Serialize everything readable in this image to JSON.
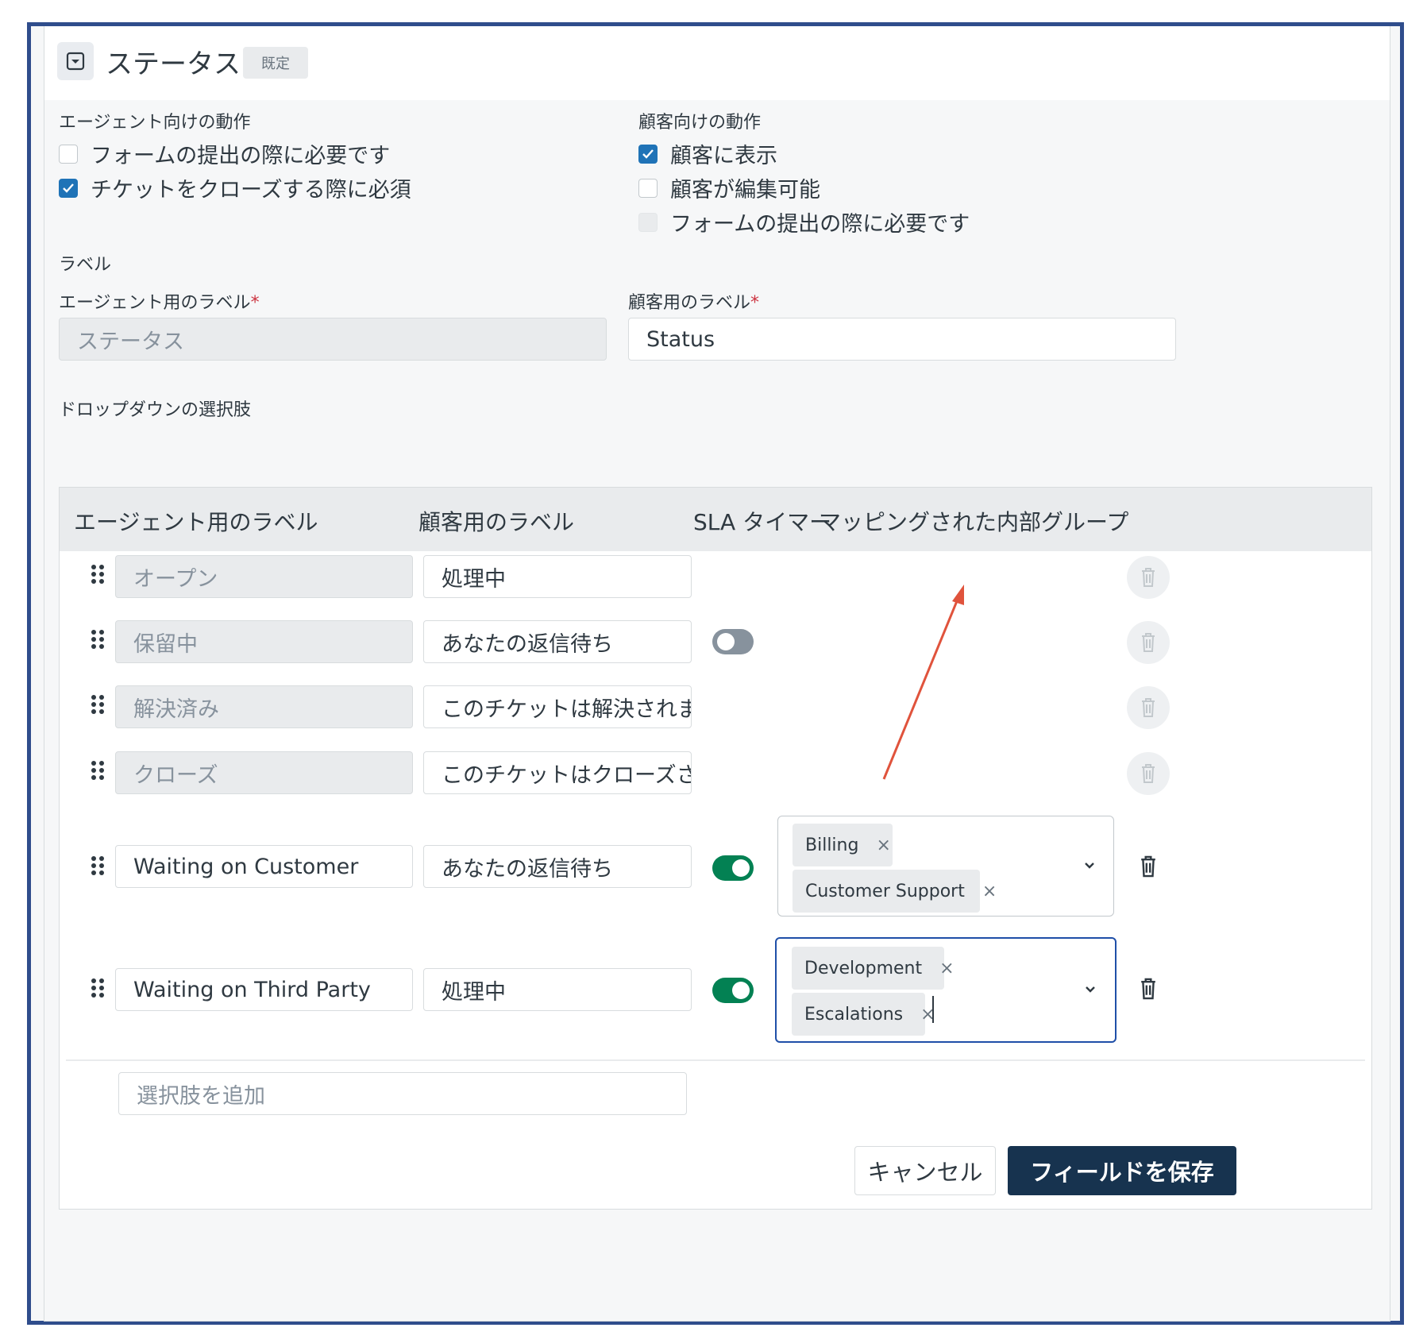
{
  "header": {
    "title": "ステータス",
    "badge": "既定",
    "icon": "dropdown-field-icon"
  },
  "agent_behavior": {
    "heading": "エージェント向けの動作",
    "options": [
      {
        "label": "フォームの提出の際に必要です",
        "checked": false
      },
      {
        "label": "チケットをクローズする際に必須",
        "checked": true
      }
    ]
  },
  "customer_behavior": {
    "heading": "顧客向けの動作",
    "options": [
      {
        "label": "顧客に表示",
        "checked": true
      },
      {
        "label": "顧客が編集可能",
        "checked": false
      },
      {
        "label": "フォームの提出の際に必要です",
        "checked": false,
        "disabled": true
      }
    ]
  },
  "labels": {
    "heading": "ラベル",
    "agent_label_title": "エージェント用のラベル",
    "customer_label_title": "顧客用のラベル",
    "required_mark": "*",
    "agent_label_value": "ステータス",
    "customer_label_value": "Status"
  },
  "dropdown": {
    "heading": "ドロップダウンの選択肢",
    "columns": [
      "エージェント用のラベル",
      "顧客用のラベル",
      "SLA タイマー",
      "マッピングされた内部グループ"
    ],
    "rows": [
      {
        "agent": "オープン",
        "customer": "処理中",
        "agent_readonly": true,
        "sla": null,
        "groups": [],
        "trash_disabled": true
      },
      {
        "agent": "保留中",
        "customer": "あなたの返信待ち",
        "agent_readonly": true,
        "sla": "off",
        "groups": [],
        "trash_disabled": true
      },
      {
        "agent": "解決済み",
        "customer": "このチケットは解決されまl",
        "agent_readonly": true,
        "sla": null,
        "groups": [],
        "trash_disabled": true
      },
      {
        "agent": "クローズ",
        "customer": "このチケットはクローズさオ",
        "agent_readonly": true,
        "sla": null,
        "groups": [],
        "trash_disabled": true
      },
      {
        "agent": "Waiting on Customer",
        "customer": "あなたの返信待ち",
        "agent_readonly": false,
        "sla": "on",
        "groups": [
          "Billing",
          "Customer Support"
        ],
        "trash_disabled": false
      },
      {
        "agent": "Waiting on Third Party",
        "customer": "処理中",
        "agent_readonly": false,
        "sla": "on",
        "groups": [
          "Development",
          "Escalations"
        ],
        "trash_disabled": false
      }
    ],
    "tag_remove": "×",
    "add_placeholder": "選択肢を追加"
  },
  "footer": {
    "cancel_label": "キャンセル",
    "save_label": "フィールドを保存"
  },
  "colors": {
    "frame_border": "#2f4d8c",
    "checkbox_checked": "#1f73b7",
    "toggle_on": "#038153",
    "toggle_off": "#87929d",
    "save_button": "#17334f",
    "annotation_arrow": "#e0533c"
  }
}
